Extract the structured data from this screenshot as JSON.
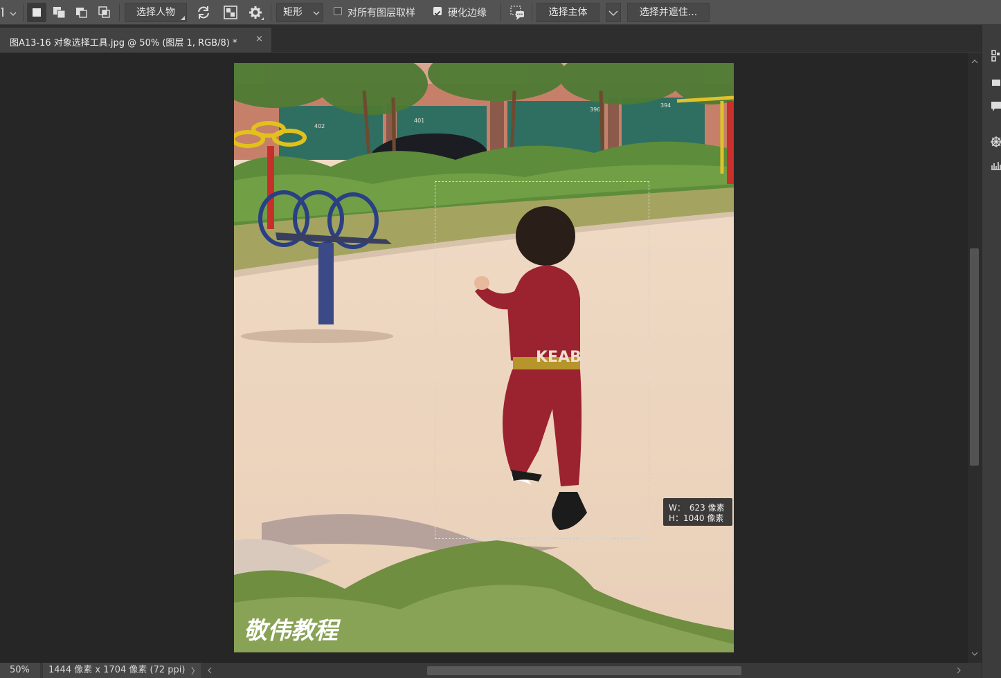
{
  "options_bar": {
    "subject_button": "选择人物",
    "mode_select": "矩形",
    "sample_all_layers_label": "对所有图层取样",
    "sample_all_layers_checked": false,
    "hard_edge_label": "硬化边缘",
    "hard_edge_checked": true,
    "select_subject_button": "选择主体",
    "select_and_mask_button": "选择并遮住..."
  },
  "document_tab": {
    "title": "图A13-16 对象选择工具.jpg @ 50% (图层 1, RGB/8) *",
    "close": "×"
  },
  "canvas": {
    "watermark": "敬伟教程",
    "shirt_text": "KEAB",
    "wall_numbers": [
      "402",
      "401",
      "396",
      "394"
    ]
  },
  "selection_tooltip": {
    "w_label": "W：",
    "w_value": "623 像素",
    "h_label": "H：",
    "h_value": "1040 像素"
  },
  "status_bar": {
    "zoom": "50%",
    "doc_info": "1444 像素 x 1704 像素 (72 ppi)",
    "arrow": "〉"
  },
  "icons": {
    "new_selection": "new-selection-icon",
    "add_selection": "add-to-selection-icon",
    "subtract_selection": "subtract-from-selection-icon",
    "intersect_selection": "intersect-selection-icon",
    "refresh": "refresh-icon",
    "mask": "mask-icon",
    "gear": "gear-icon"
  },
  "colors": {
    "app_bg": "#262626",
    "toolbar": "#535353",
    "panel": "#3c3c3c",
    "selection_ant": "#111111"
  }
}
